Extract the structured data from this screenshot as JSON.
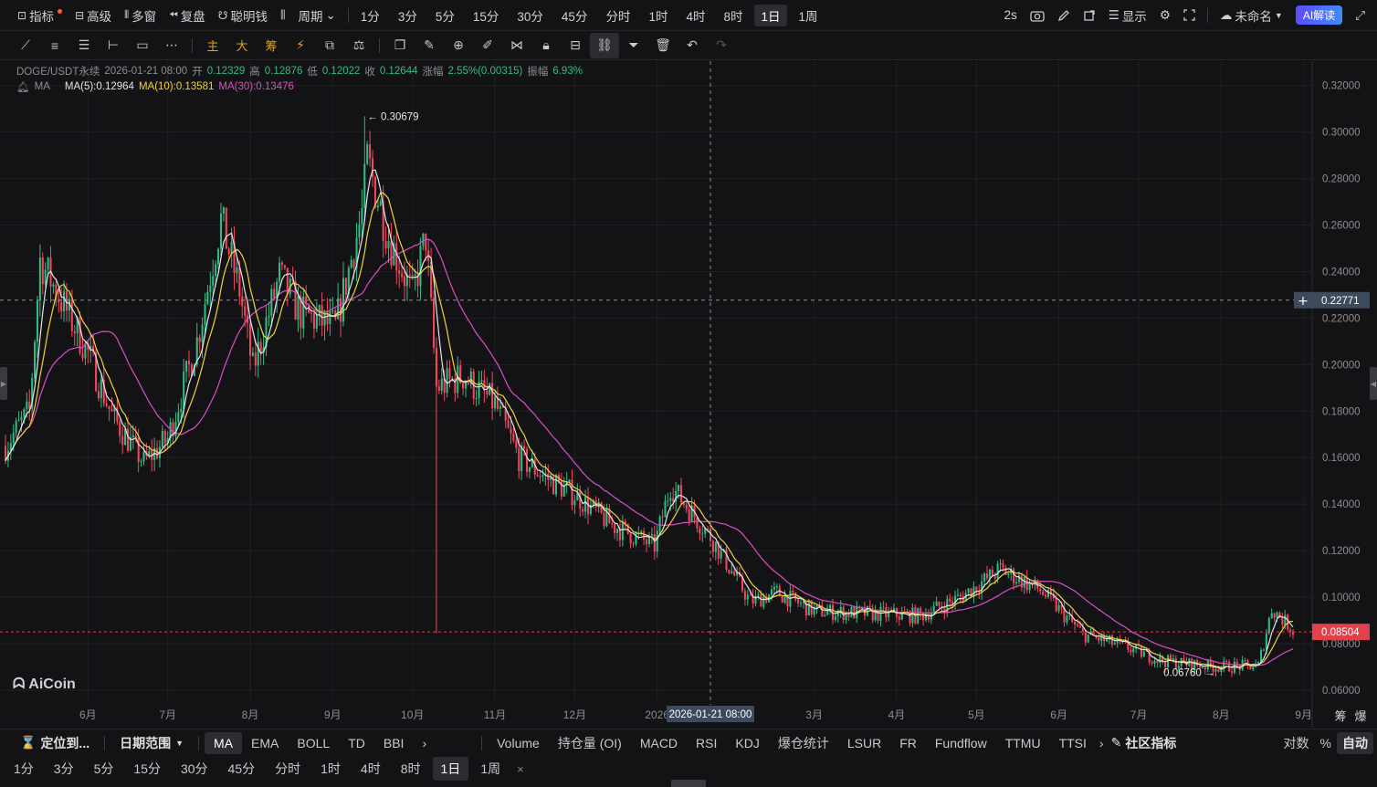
{
  "top_bar": {
    "left": [
      {
        "icon": "indicator-icon",
        "label": "指标",
        "dot": true
      },
      {
        "icon": "advanced-icon",
        "label": "高级"
      },
      {
        "icon": "multi-window-icon",
        "label": "多窗"
      },
      {
        "icon": "replay-icon",
        "label": "复盘"
      },
      {
        "icon": "smart-money-icon",
        "label": "聪明钱"
      },
      {
        "icon": "candle-type-icon",
        "label": ""
      },
      {
        "icon": "",
        "label": "周期",
        "chevron": true
      }
    ],
    "periods": [
      "1分",
      "3分",
      "5分",
      "15分",
      "30分",
      "45分",
      "分时",
      "1时",
      "4时",
      "8时",
      "1日",
      "1周"
    ],
    "active_period": "1日",
    "right": {
      "refresh": "2s",
      "display_label": "显示",
      "layout_name": "未命名",
      "ai_label": "AI解读"
    }
  },
  "drawing_tools": {
    "text_tools": [
      "主",
      "大",
      "筹"
    ]
  },
  "info": {
    "symbol": "DOGE/USDT永续",
    "time": "2026-01-21 08:00",
    "open_label": "开",
    "open": "0.12329",
    "high_label": "高",
    "high": "0.12876",
    "low_label": "低",
    "low": "0.12022",
    "close_label": "收",
    "close": "0.12644",
    "change_label": "涨幅",
    "change": "2.55%(0.00315)",
    "amp_label": "振幅",
    "amp": "6.93%",
    "ma_title": "MA",
    "ma5": "MA(5):0.12964",
    "ma10": "MA(10):0.13581",
    "ma30": "MA(30):0.13476"
  },
  "watermark": "AiCoin",
  "colors": {
    "up": "#2ebd85",
    "down": "#f6465d",
    "ma5": "#e5e5e5",
    "ma10": "#f0d23c",
    "ma30": "#d94fc4",
    "current_price_bg": "#e0414b",
    "crosshair_label_bg": "#3c4a5c"
  },
  "chart_data": {
    "type": "candlestick",
    "y_ticks": [
      "0.32000",
      "0.30000",
      "0.28000",
      "0.26000",
      "0.24000",
      "0.22000",
      "0.20000",
      "0.18000",
      "0.16000",
      "0.14000",
      "0.12000",
      "0.10000",
      "0.08000",
      "0.06000"
    ],
    "ylim": [
      0.058,
      0.325
    ],
    "x_ticks": [
      "6月",
      "7月",
      "8月",
      "9月",
      "10月",
      "11月",
      "12月",
      "2026",
      "3月",
      "4月",
      "5月",
      "6月",
      "7月",
      "8月",
      "9月"
    ],
    "start_date": "2025-05-01",
    "end_date": "2026-08-28",
    "price_path": [
      [
        "2025-05-01",
        0.165
      ],
      [
        "2025-05-10",
        0.18
      ],
      [
        "2025-05-14",
        0.245
      ],
      [
        "2025-05-20",
        0.232
      ],
      [
        "2025-06-01",
        0.205
      ],
      [
        "2025-06-10",
        0.178
      ],
      [
        "2025-06-22",
        0.158
      ],
      [
        "2025-07-01",
        0.168
      ],
      [
        "2025-07-12",
        0.21
      ],
      [
        "2025-07-21",
        0.262
      ],
      [
        "2025-07-28",
        0.232
      ],
      [
        "2025-08-02",
        0.198
      ],
      [
        "2025-08-12",
        0.238
      ],
      [
        "2025-08-20",
        0.222
      ],
      [
        "2025-09-02",
        0.216
      ],
      [
        "2025-09-12",
        0.265
      ],
      [
        "2025-09-14",
        0.288
      ],
      [
        "2025-09-22",
        0.255
      ],
      [
        "2025-10-01",
        0.23
      ],
      [
        "2025-10-06",
        0.255
      ],
      [
        "2025-10-10",
        0.19
      ],
      [
        "2025-10-20",
        0.195
      ],
      [
        "2025-11-01",
        0.183
      ],
      [
        "2025-11-10",
        0.16
      ],
      [
        "2025-11-22",
        0.15
      ],
      [
        "2025-12-01",
        0.144
      ],
      [
        "2025-12-15",
        0.131
      ],
      [
        "2025-12-31",
        0.122
      ],
      [
        "2026-01-06",
        0.148
      ],
      [
        "2026-01-21",
        0.126
      ],
      [
        "2026-02-05",
        0.098
      ],
      [
        "2026-02-15",
        0.102
      ],
      [
        "2026-03-01",
        0.094
      ],
      [
        "2026-03-20",
        0.093
      ],
      [
        "2026-04-10",
        0.092
      ],
      [
        "2026-04-25",
        0.1
      ],
      [
        "2026-05-10",
        0.112
      ],
      [
        "2026-05-25",
        0.103
      ],
      [
        "2026-06-10",
        0.084
      ],
      [
        "2026-06-25",
        0.079
      ],
      [
        "2026-07-10",
        0.0725
      ],
      [
        "2026-07-31",
        0.07
      ],
      [
        "2026-08-15",
        0.0705
      ],
      [
        "2026-08-20",
        0.095
      ],
      [
        "2026-08-28",
        0.086
      ]
    ],
    "max_label": {
      "value": "0.30679",
      "date": "2025-09-13",
      "price": 0.30679
    },
    "min_label": {
      "value": "0.06760",
      "date": "2026-07-31",
      "price": 0.0676
    },
    "spike_low": {
      "date": "2025-10-10",
      "price": 0.0845
    },
    "current_price": {
      "value": "0.08504",
      "price": 0.08504
    },
    "crosshair": {
      "price_label": "0.22771",
      "price": 0.22771,
      "date_label": "2026-01-21 08:00",
      "date": "2026-01-21"
    }
  },
  "indicator_bar": {
    "locate_label": "定位到...",
    "date_range_label": "日期范围",
    "main_indicators": [
      "MA",
      "EMA",
      "BOLL",
      "TD",
      "BBI"
    ],
    "active_main": "MA",
    "sub_indicators": [
      "Volume",
      "持仓量 (OI)",
      "MACD",
      "RSI",
      "KDJ",
      "爆仓统计",
      "LSUR",
      "FR",
      "Fundflow",
      "TTMU",
      "TTSI"
    ],
    "community_label": "社区指标",
    "log_label": "对数",
    "pct_label": "%",
    "auto_label": "自动"
  },
  "period_bar": {
    "periods": [
      "1分",
      "3分",
      "5分",
      "15分",
      "30分",
      "45分",
      "分时",
      "1时",
      "4时",
      "8时",
      "1日",
      "1周"
    ],
    "active": "1日",
    "close": "×"
  },
  "side_labels": [
    "筹",
    "爆"
  ]
}
